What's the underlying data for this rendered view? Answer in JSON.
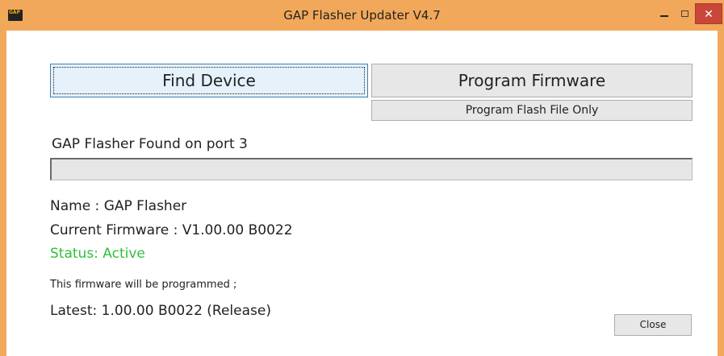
{
  "window": {
    "title": "GAP Flasher Updater V4.7",
    "icon_text": "GAP",
    "close_glyph": "✕",
    "colors": {
      "frame": "#f2a85a",
      "close_button": "#c94639",
      "status_text": "#2fbf3a"
    }
  },
  "buttons": {
    "find_device": "Find Device",
    "program_firmware": "Program Firmware",
    "program_flash_only": "Program Flash File Only",
    "close": "Close"
  },
  "device": {
    "found_message": "GAP Flasher Found on port 3",
    "progress": 0,
    "name_line": "Name : GAP Flasher",
    "firmware_line": "Current Firmware : V1.00.00 B0022",
    "status_line": "Status: Active"
  },
  "update": {
    "note": "This firmware will be programmed ;",
    "latest": "Latest: 1.00.00 B0022 (Release)"
  }
}
